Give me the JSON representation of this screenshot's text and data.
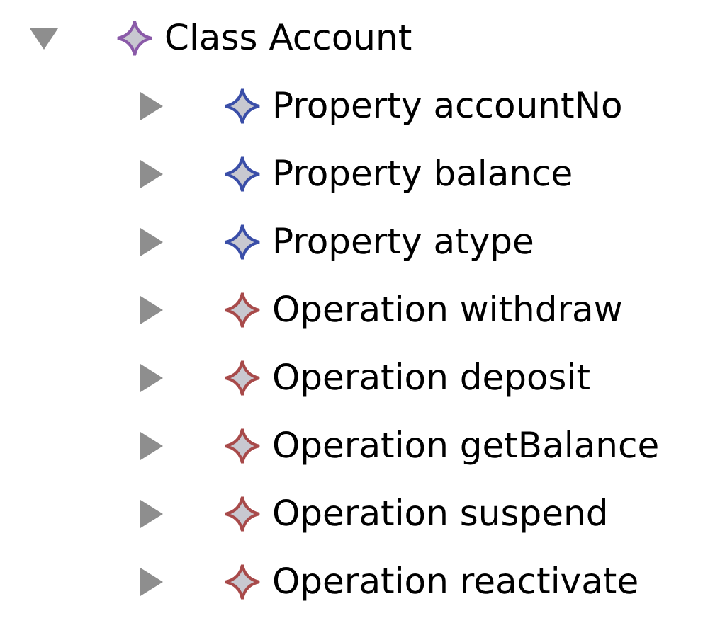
{
  "tree": [
    {
      "label": "Class Account",
      "expanded": true,
      "color": "#8a5aa8",
      "children": [
        {
          "label": "Property accountNo",
          "expanded": false,
          "color": "#3a4ea8"
        },
        {
          "label": "Property balance",
          "expanded": false,
          "color": "#3a4ea8"
        },
        {
          "label": "Property atype",
          "expanded": false,
          "color": "#3a4ea8"
        },
        {
          "label": "Operation withdraw",
          "expanded": false,
          "color": "#a84a4a"
        },
        {
          "label": "Operation deposit",
          "expanded": false,
          "color": "#a84a4a"
        },
        {
          "label": "Operation getBalance",
          "expanded": false,
          "color": "#a84a4a"
        },
        {
          "label": "Operation suspend",
          "expanded": false,
          "color": "#a84a4a"
        },
        {
          "label": "Operation reactivate",
          "expanded": false,
          "color": "#a84a4a"
        }
      ]
    }
  ]
}
